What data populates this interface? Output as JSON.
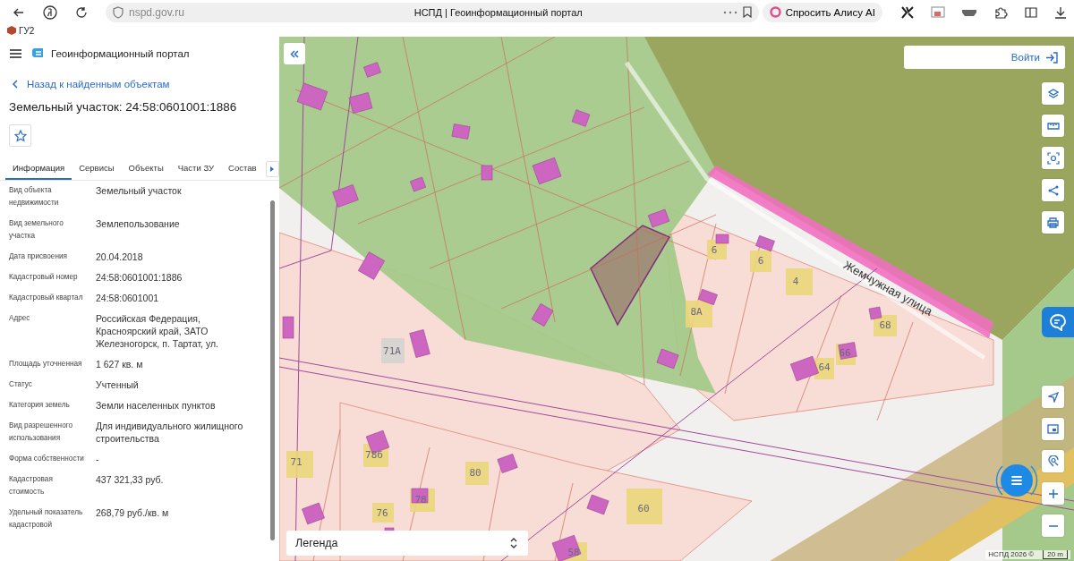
{
  "browser": {
    "url": "nspd.gov.ru",
    "tab_title": "НСПД | Геоинформационный портал",
    "alice_button": "Спросить Алису AI",
    "bookmarks": [
      {
        "label": "ГУ2"
      }
    ]
  },
  "header": {
    "title": "Геоинформационный портал"
  },
  "back_link": "Назад к найденным объектам",
  "object_title": "Земельный участок: 24:58:0601001:1886",
  "favorite": {
    "selected": false
  },
  "tabs": [
    {
      "label": "Информация",
      "selected": true
    },
    {
      "label": "Сервисы",
      "selected": false
    },
    {
      "label": "Объекты",
      "selected": false
    },
    {
      "label": "Части ЗУ",
      "selected": false
    },
    {
      "label": "Состав",
      "selected": false
    }
  ],
  "fields": [
    {
      "label": "Вид объекта недвижимости",
      "value": "Земельный участок"
    },
    {
      "label": "Вид земельного участка",
      "value": "Землепользование"
    },
    {
      "label": "Дата присвоения",
      "value": "20.04.2018"
    },
    {
      "label": "Кадастровый номер",
      "value": "24:58:0601001:1886"
    },
    {
      "label": "Кадастровый квартал",
      "value": "24:58:0601001"
    },
    {
      "label": "Адрес",
      "value": "Российская Федерация, Красноярский край, ЗАТО Железногорск, п. Тартат, ул."
    },
    {
      "label": "Площадь уточненная",
      "value": "1 627 кв. м"
    },
    {
      "label": "Статус",
      "value": "Учтенный"
    },
    {
      "label": "Категория земель",
      "value": "Земли населенных пунктов"
    },
    {
      "label": "Вид разрешенного использования",
      "value": "Для индивидуального жилищного строительства"
    },
    {
      "label": "Форма собственности",
      "value": "-"
    },
    {
      "label": "Кадастровая стоимость",
      "value": "437 321,33 руб."
    },
    {
      "label": "Удельный показатель кадастровой",
      "value": "268,79 руб./кв. м"
    }
  ],
  "map": {
    "labels": [
      "6",
      "6",
      "4",
      "8А",
      "71А",
      "66",
      "64",
      "68",
      "78б",
      "80",
      "78",
      "76",
      "60",
      "58",
      "71"
    ],
    "street": "Жемчужная улица",
    "login_button": "Войти",
    "legend": "Легенда",
    "attribution": "НСПД 2026 ©",
    "scale": "20 m"
  }
}
